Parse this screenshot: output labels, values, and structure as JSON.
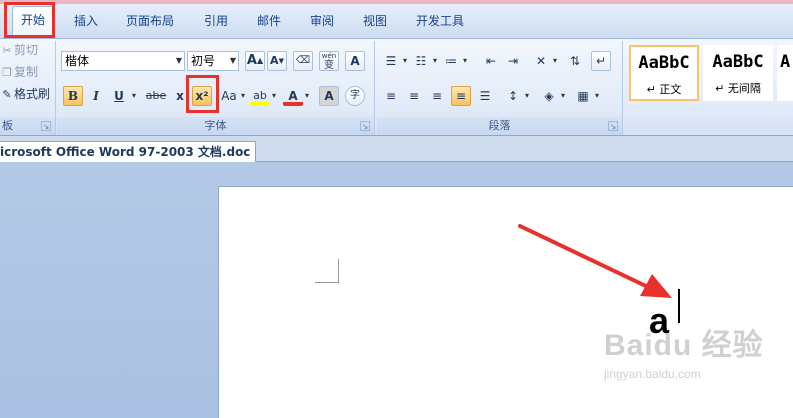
{
  "tabs": [
    {
      "label": "开始"
    },
    {
      "label": "插入"
    },
    {
      "label": "页面布局"
    },
    {
      "label": "引用"
    },
    {
      "label": "邮件"
    },
    {
      "label": "审阅"
    },
    {
      "label": "视图"
    },
    {
      "label": "开发工具"
    }
  ],
  "clipboard": {
    "cut": "剪切",
    "copy": "复制",
    "format_painter": "格式刷",
    "group_label": "板"
  },
  "font": {
    "font_name": "楷体",
    "font_size": "初号",
    "grow": "A",
    "shrink": "A",
    "phonetic": "wén",
    "border_char": "A",
    "bold": "B",
    "italic": "I",
    "underline": "U",
    "strike": "abe",
    "subscript": "x",
    "superscript": "x²",
    "change_case": "Aa",
    "highlight": "ab",
    "font_color": "A",
    "char_shading": "A",
    "enclose": "字",
    "group_label": "字体"
  },
  "paragraph": {
    "group_label": "段落"
  },
  "styles": [
    {
      "sample": "AaBbC",
      "name": "↵ 正文"
    },
    {
      "sample": "AaBbC",
      "name": "↵ 无间隔"
    },
    {
      "sample": "A",
      "name": ""
    }
  ],
  "document": {
    "tab_title": "icrosoft Office Word 97-2003 文档.doc *",
    "typed_char": "a"
  },
  "watermark": {
    "main": "Baidu 经验",
    "sub": "jingyan.baidu.com"
  },
  "colors": {
    "highlight_annotation": "#e8312b",
    "highlight_marker": "#ffff00",
    "font_color_bar": "#e8312b"
  }
}
